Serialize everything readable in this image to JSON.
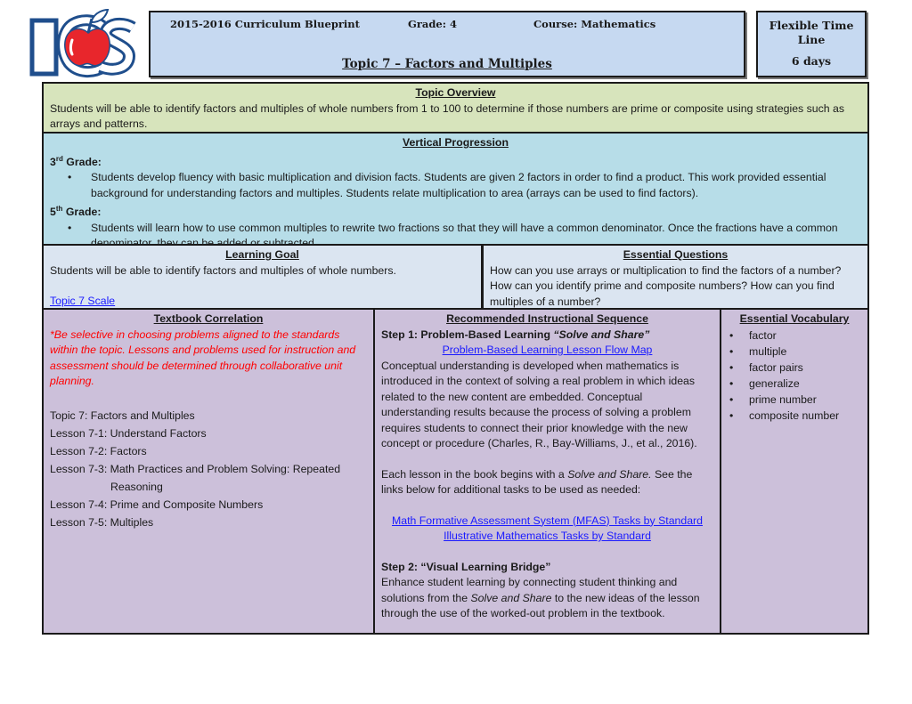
{
  "header": {
    "blueprint": "2015-2016 Curriculum Blueprint",
    "grade": "Grade:  4",
    "course": "Course:  Mathematics",
    "topic_title": "Topic 7 – Factors and Multiples",
    "timeline_label": "Flexible Time Line",
    "timeline_value": "6 days"
  },
  "logo": {
    "text": "ICS",
    "icon": "apple-icon",
    "colors": {
      "letters": "#1f4e8c",
      "apple": "#e8262c"
    }
  },
  "overview": {
    "heading": "Topic Overview",
    "text": "Students will be able to identify factors and multiples of whole numbers from 1 to 100 to determine if those numbers are prime or composite using strategies such as arrays and patterns."
  },
  "vertical": {
    "heading": "Vertical Progression",
    "grades": [
      {
        "num": "3",
        "sup": "rd",
        "label": " Grade:",
        "bullet": "Students develop fluency with basic multiplication and division facts. Students are given 2 factors in order to find a product. This work provided essential background for understanding factors and multiples. Students relate multiplication to area (arrays can be used to find factors)."
      },
      {
        "num": "5",
        "sup": "th",
        "label": " Grade:",
        "bullet": "Students will learn how to use common multiples to rewrite two fractions so that they will have a common denominator. Once the fractions have a common denominator, they can be added or subtracted."
      }
    ]
  },
  "learning_goal": {
    "heading": "Learning Goal",
    "text": "Students will be able to identify factors and multiples of whole numbers.",
    "link": "Topic 7 Scale"
  },
  "essential_questions": {
    "heading": "Essential Questions",
    "text": "How can you use arrays or multiplication to find the factors of a number? How can you identify prime and composite numbers? How can you find multiples of a number?"
  },
  "textbook": {
    "heading": "Textbook Correlation",
    "note": "*Be selective in choosing problems aligned to the standards within the topic. Lessons and problems used for instruction and assessment should be determined through collaborative unit planning.",
    "items": [
      "Topic 7: Factors and Multiples",
      "Lesson 7-1: Understand Factors",
      "Lesson 7-2: Factors",
      "Lesson 7-3: Math Practices and Problem Solving: Repeated",
      "Reasoning",
      "Lesson 7-4: Prime and Composite Numbers",
      "Lesson 7-5: Multiples"
    ]
  },
  "sequence": {
    "heading": "Recommended Instructional Sequence",
    "step1_label": "Step 1: Problem-Based Learning ",
    "step1_italic": "“Solve and Share”",
    "step1_link": "Problem-Based Learning Lesson Flow Map",
    "step1_text": "Conceptual understanding is developed when mathematics is introduced in the context of solving a real problem in which ideas related to the new content are embedded. Conceptual understanding results because the process of solving a problem requires students to connect their prior knowledge with the new concept or procedure (Charles, R., Bay-Williams, J., et al., 2016).",
    "each_lesson_a": "Each lesson in the book begins with a ",
    "each_lesson_italic": "Solve and Share.",
    "each_lesson_b": " See the links below for additional tasks to be used as needed:",
    "links": [
      "Math Formative Assessment System (MFAS) Tasks by Standard",
      "Illustrative Mathematics Tasks by Standard"
    ],
    "step2_label": "Step 2: “Visual Learning Bridge”",
    "step2_a": "Enhance student learning by connecting student thinking and solutions from the ",
    "step2_italic": "Solve and Share",
    "step2_b": " to the new ideas of the lesson through the use of the worked-out problem in the textbook."
  },
  "vocabulary": {
    "heading": "Essential Vocabulary",
    "items": [
      "factor",
      "multiple",
      "factor pairs",
      "generalize",
      "prime number",
      "composite number"
    ]
  }
}
